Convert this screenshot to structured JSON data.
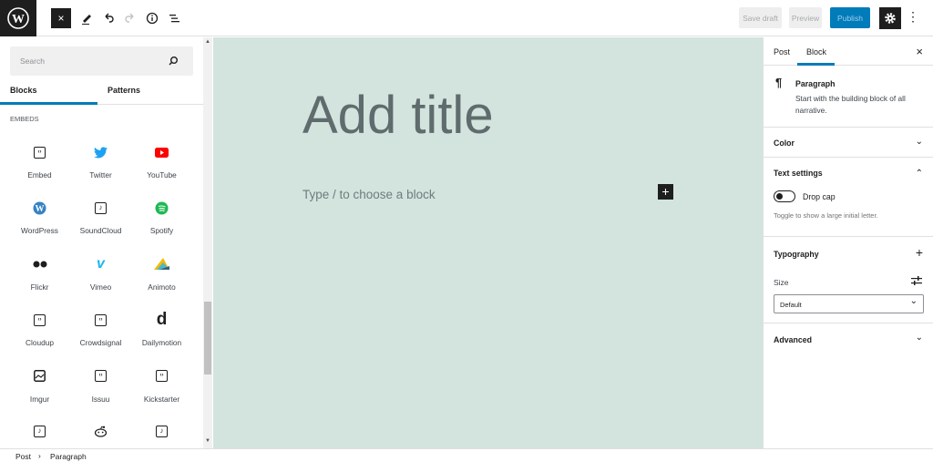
{
  "toolbar": {
    "close_label": "×",
    "save_draft": "Save draft",
    "preview": "Preview",
    "publish": "Publish",
    "more": "⋮"
  },
  "inserter": {
    "search_placeholder": "Search",
    "tabs": [
      "Blocks",
      "Patterns"
    ],
    "active_tab": "Blocks",
    "category": "EMBEDS",
    "blocks": [
      {
        "label": "Embed",
        "icon": "embed-icon"
      },
      {
        "label": "Twitter",
        "icon": "twitter-icon"
      },
      {
        "label": "YouTube",
        "icon": "youtube-icon"
      },
      {
        "label": "WordPress",
        "icon": "wordpress-icon"
      },
      {
        "label": "SoundCloud",
        "icon": "audio-icon"
      },
      {
        "label": "Spotify",
        "icon": "spotify-icon"
      },
      {
        "label": "Flickr",
        "icon": "flickr-icon"
      },
      {
        "label": "Vimeo",
        "icon": "vimeo-icon"
      },
      {
        "label": "Animoto",
        "icon": "animoto-icon"
      },
      {
        "label": "Cloudup",
        "icon": "embed-icon"
      },
      {
        "label": "Crowdsignal",
        "icon": "embed-icon"
      },
      {
        "label": "Dailymotion",
        "icon": "dailymotion-icon"
      },
      {
        "label": "Imgur",
        "icon": "image-icon"
      },
      {
        "label": "Issuu",
        "icon": "embed-icon"
      },
      {
        "label": "Kickstarter",
        "icon": "embed-icon"
      },
      {
        "label": "",
        "icon": "audio-icon"
      },
      {
        "label": "",
        "icon": "reddit-icon"
      },
      {
        "label": "",
        "icon": "audio-icon"
      }
    ]
  },
  "editor": {
    "title_placeholder": "Add title",
    "block_placeholder": "Type / to choose a block",
    "add_block": "+"
  },
  "sidebar": {
    "tabs": [
      "Post",
      "Block"
    ],
    "active_tab": "Block",
    "close": "×",
    "block_card": {
      "icon": "¶",
      "name": "Paragraph",
      "description": "Start with the building block of all narrative."
    },
    "color": "Color",
    "text_settings": "Text settings",
    "drop_cap": "Drop cap",
    "drop_cap_enabled": false,
    "drop_cap_help": "Toggle to show a large initial letter.",
    "typography": "Typography",
    "size_label": "Size",
    "size_value": "Default",
    "advanced": "Advanced"
  },
  "breadcrumb": [
    "Post",
    "Paragraph"
  ],
  "colors": {
    "accent": "#007cba",
    "canvas": "#d2e4dd",
    "dark": "#1e1e1e"
  }
}
